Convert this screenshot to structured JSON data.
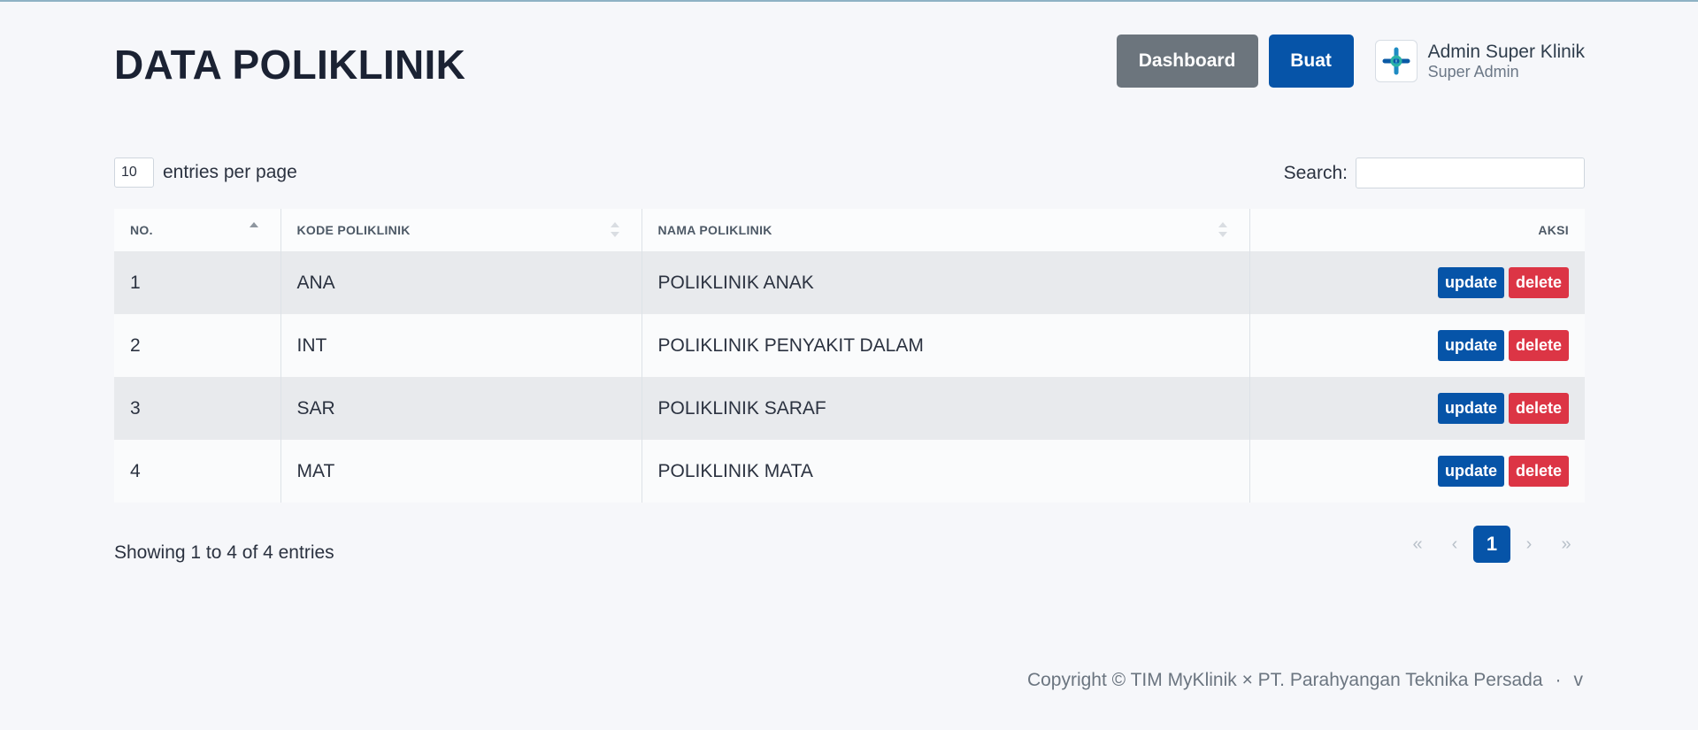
{
  "page": {
    "title": "DATA POLIKLINIK"
  },
  "header": {
    "dashboard_label": "Dashboard",
    "create_label": "Buat",
    "user": {
      "name": "Admin Super Klinik",
      "role": "Super Admin"
    }
  },
  "table_controls": {
    "entries_value": "10",
    "entries_label": "entries per page",
    "search_label": "Search:",
    "search_value": ""
  },
  "table": {
    "columns": [
      "NO.",
      "KODE POLIKLINIK",
      "NAMA POLIKLINIK",
      "AKSI"
    ],
    "sort": {
      "column": "NO.",
      "direction": "asc"
    },
    "rows": [
      {
        "no": "1",
        "kode": "ANA",
        "nama": "POLIKLINIK ANAK"
      },
      {
        "no": "2",
        "kode": "INT",
        "nama": "POLIKLINIK PENYAKIT DALAM"
      },
      {
        "no": "3",
        "kode": "SAR",
        "nama": "POLIKLINIK SARAF"
      },
      {
        "no": "4",
        "kode": "MAT",
        "nama": "POLIKLINIK MATA"
      }
    ],
    "update_label": "update",
    "delete_label": "delete"
  },
  "footer_info": {
    "showing": "Showing 1 to 4 of 4 entries"
  },
  "pagination": {
    "first": "«",
    "prev": "‹",
    "current": "1",
    "next": "›",
    "last": "»"
  },
  "footer": {
    "copyright": "Copyright © TIM MyKlinik × PT. Parahyangan Teknika Persada",
    "separator": "·",
    "version": "v"
  },
  "colors": {
    "primary": "#0654a8",
    "secondary": "#6c757d",
    "danger": "#dc3545",
    "background": "#f6f7fa"
  },
  "icons": {
    "avatar": "clinic-logo-icon",
    "sort_asc": "sort-asc-icon",
    "sort_both": "sort-both-icon"
  }
}
